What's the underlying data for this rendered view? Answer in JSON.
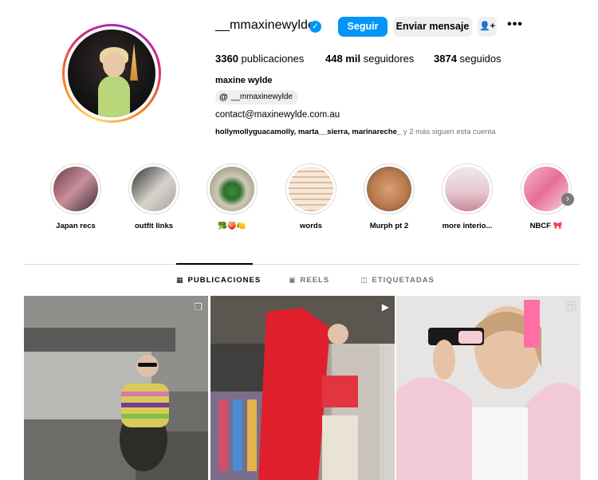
{
  "profile": {
    "username": "__mmaxinewylde",
    "full_name": "maxine wylde",
    "threads_handle": "__mmaxinewylde",
    "email": "contact@maxinewylde.com.au",
    "followed_by_names": "hollymollyguacamolly, marta__sierra, marinareche_",
    "followed_by_suffix": " y 2 más siguen esta cuenta"
  },
  "actions": {
    "follow_label": "Seguir",
    "message_label": "Enviar mensaje",
    "more_label": "•••"
  },
  "stats": {
    "posts_count": "3360",
    "posts_label": "publicaciones",
    "followers_count": "448 mil",
    "followers_label": "seguidores",
    "following_count": "3874",
    "following_label": "seguidos"
  },
  "highlights": [
    {
      "label": "Japan recs"
    },
    {
      "label": "outfit links"
    },
    {
      "label": "🥦🍑🍋"
    },
    {
      "label": "words"
    },
    {
      "label": "Murph pt 2"
    },
    {
      "label": "more interio..."
    },
    {
      "label": "NBCF 🎀"
    }
  ],
  "tabs": {
    "posts": "PUBLICACIONES",
    "reels": "REELS",
    "tagged": "ETIQUETADAS"
  },
  "icons": {
    "verified": "verified-badge-icon",
    "suggest": "person-plus-icon",
    "threads": "threads-icon",
    "next": "chevron-right-icon"
  },
  "colors": {
    "accent": "#0095f6",
    "button_secondary": "#efefef",
    "muted_text": "#737373"
  }
}
